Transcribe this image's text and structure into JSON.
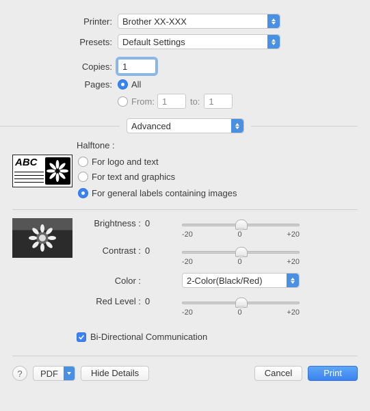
{
  "printer": {
    "label": "Printer:",
    "value": "Brother XX-XXX"
  },
  "presets": {
    "label": "Presets:",
    "value": "Default Settings"
  },
  "copies": {
    "label": "Copies:",
    "value": "1"
  },
  "pages": {
    "label": "Pages:",
    "all_label": "All",
    "from_label": "From:",
    "to_label": "to:",
    "from_value": "1",
    "to_value": "1"
  },
  "section_select": "Advanced",
  "halftone": {
    "label": "Halftone :",
    "logo_text": "For logo and text",
    "text_graphics": "For text and graphics",
    "general_images": "For general labels containing images",
    "sample_text": "ABC"
  },
  "brightness": {
    "label": "Brightness :",
    "value": "0",
    "min": "-20",
    "mid": "0",
    "max": "+20"
  },
  "contrast": {
    "label": "Contrast :",
    "value": "0",
    "min": "-20",
    "mid": "0",
    "max": "+20"
  },
  "color": {
    "label": "Color :",
    "value": "2-Color(Black/Red)"
  },
  "redlevel": {
    "label": "Red Level :",
    "value": "0",
    "min": "-20",
    "mid": "0",
    "max": "+20"
  },
  "bidi_label": "Bi-Directional Communication",
  "footer": {
    "pdf": "PDF",
    "hide_details": "Hide Details",
    "cancel": "Cancel",
    "print": "Print",
    "help": "?"
  }
}
